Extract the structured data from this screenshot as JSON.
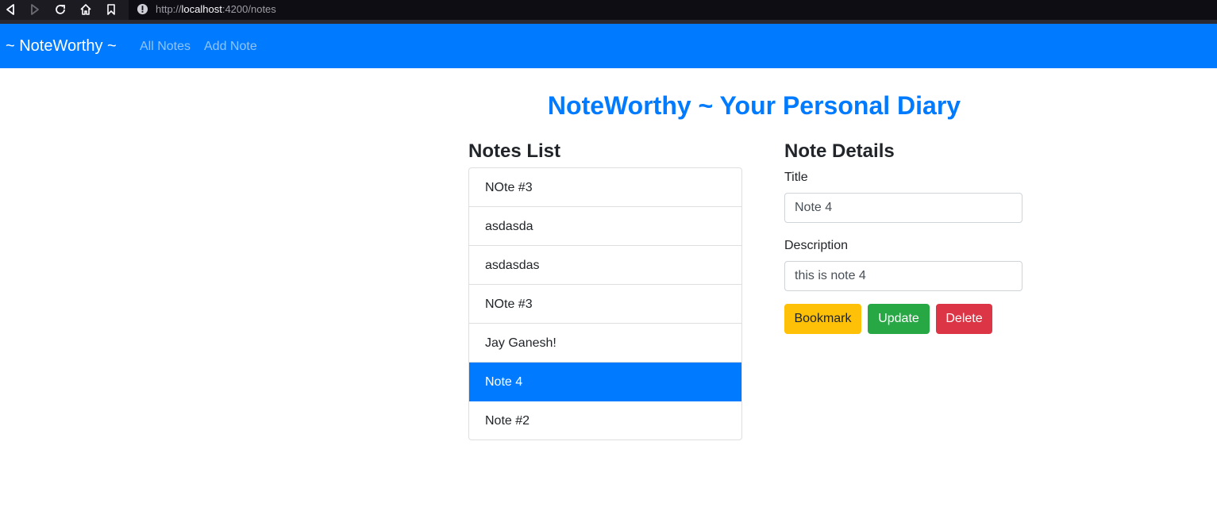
{
  "browser": {
    "url_prefix": "http://",
    "url_host": "localhost",
    "url_rest": ":4200/notes"
  },
  "navbar": {
    "brand": "~ NoteWorthy ~",
    "links": [
      "All Notes",
      "Add Note"
    ]
  },
  "main": {
    "title": "NoteWorthy ~ Your Personal Diary",
    "notes_heading": "Notes List",
    "details_heading": "Note Details",
    "notes": [
      "NOte #3",
      "asdasda",
      "asdasdas",
      "NOte #3",
      "Jay Ganesh!",
      "Note 4",
      "Note #2"
    ],
    "active_note": "Note 4",
    "form": {
      "title_label": "Title",
      "title_value": "Note 4",
      "description_label": "Description",
      "description_value": "this is note 4"
    },
    "buttons": {
      "bookmark": "Bookmark",
      "update": "Update",
      "delete": "Delete"
    }
  },
  "colors": {
    "primary": "#007bff",
    "warning": "#ffc107",
    "success": "#28a745",
    "danger": "#dc3545"
  }
}
